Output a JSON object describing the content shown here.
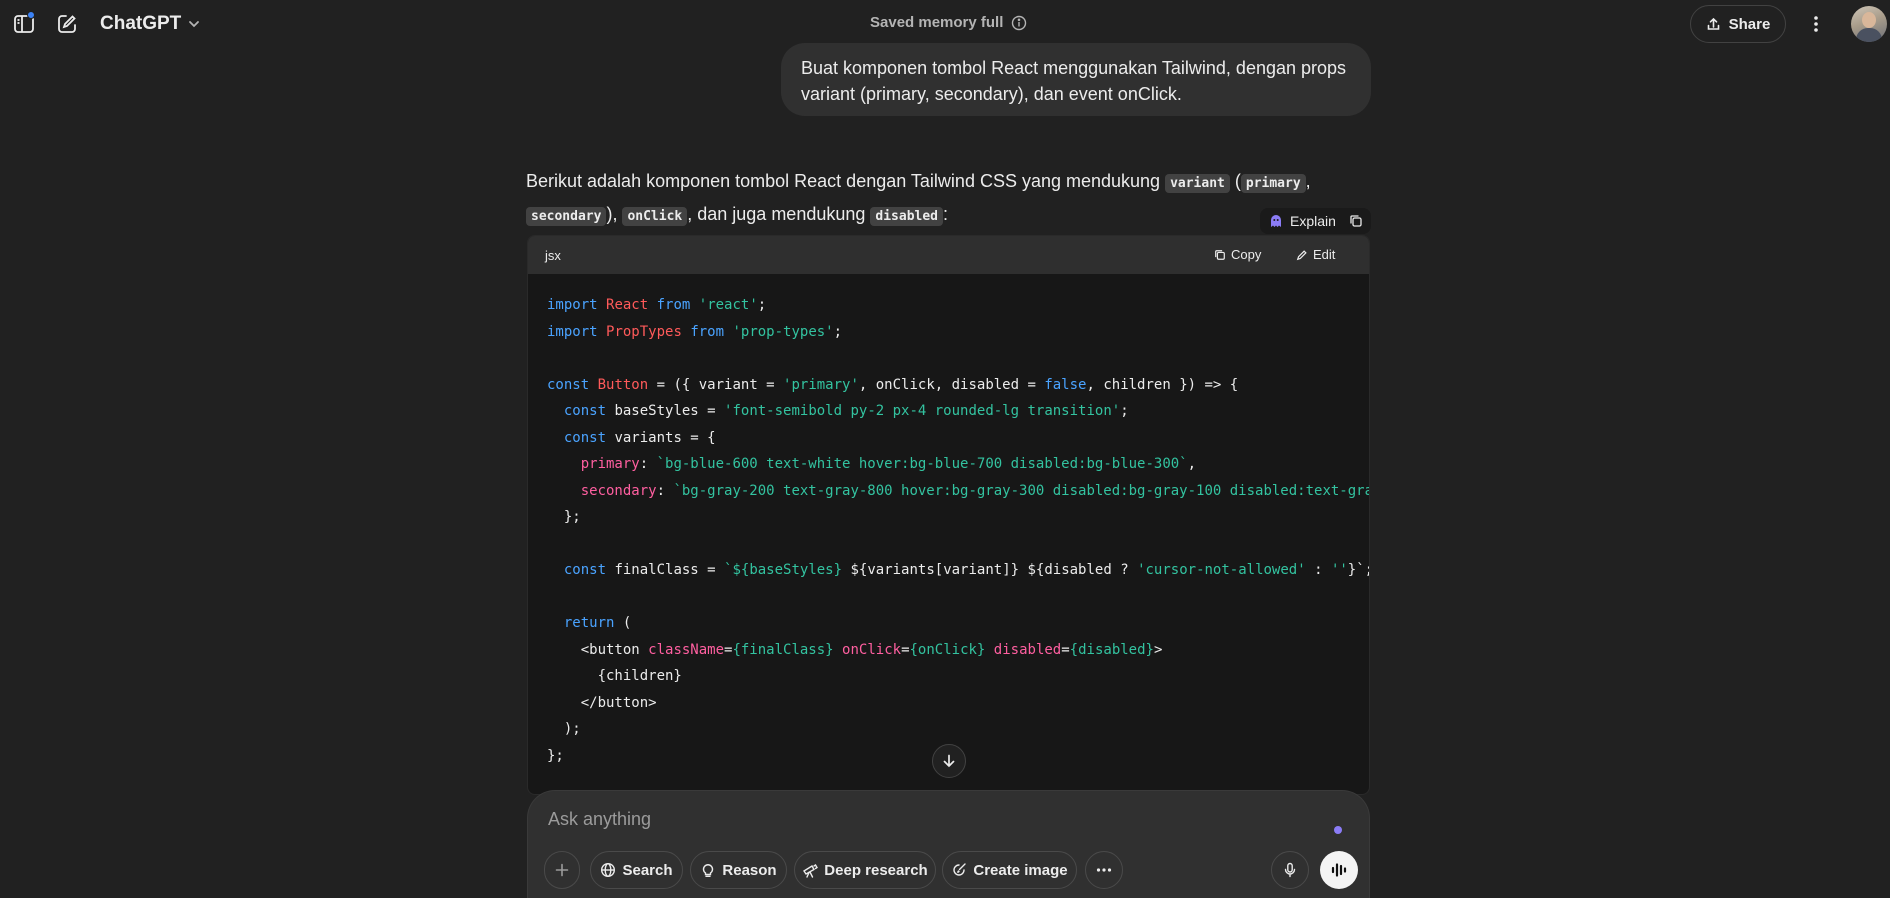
{
  "header": {
    "model_name": "ChatGPT",
    "memory_status": "Saved memory full",
    "share_label": "Share"
  },
  "user_message": {
    "text": "Buat komponen tombol React menggunakan Tailwind, dengan props variant (primary, secondary), dan event onClick."
  },
  "assistant": {
    "intro_1": "Berikut adalah komponen tombol React dengan Tailwind CSS yang mendukung ",
    "code_variant": "variant",
    "paren_open": " (",
    "code_primary": "primary",
    "comma_1": ",",
    "code_secondary": "secondary",
    "paren_close": "), ",
    "code_onclick": "onClick",
    "intro_2": ", dan juga mendukung ",
    "code_disabled": "disabled",
    "colon": ":",
    "explain_label": "Explain"
  },
  "code_block": {
    "language": "jsx",
    "copy_label": "Copy",
    "edit_label": "Edit",
    "lines": [
      [
        [
          "kw",
          "import"
        ],
        [
          "p",
          " "
        ],
        [
          "tp",
          "React"
        ],
        [
          "p",
          " "
        ],
        [
          "kw",
          "from"
        ],
        [
          "p",
          " "
        ],
        [
          "str",
          "'react'"
        ],
        [
          "p",
          ";"
        ]
      ],
      [
        [
          "kw",
          "import"
        ],
        [
          "p",
          " "
        ],
        [
          "tp",
          "PropTypes"
        ],
        [
          "p",
          " "
        ],
        [
          "kw",
          "from"
        ],
        [
          "p",
          " "
        ],
        [
          "str",
          "'prop-types'"
        ],
        [
          "p",
          ";"
        ]
      ],
      [],
      [
        [
          "kw",
          "const"
        ],
        [
          "p",
          " "
        ],
        [
          "tp",
          "Button"
        ],
        [
          "p",
          " = ({ variant = "
        ],
        [
          "str",
          "'primary'"
        ],
        [
          "p",
          ", onClick, disabled = "
        ],
        [
          "boo",
          "false"
        ],
        [
          "p",
          ", children }) => {"
        ]
      ],
      [
        [
          "p",
          "  "
        ],
        [
          "kw",
          "const"
        ],
        [
          "p",
          " baseStyles = "
        ],
        [
          "str",
          "'font-semibold py-2 px-4 rounded-lg transition'"
        ],
        [
          "p",
          ";"
        ]
      ],
      [
        [
          "p",
          "  "
        ],
        [
          "kw",
          "const"
        ],
        [
          "p",
          " variants = {"
        ]
      ],
      [
        [
          "p",
          "    "
        ],
        [
          "prop",
          "primary"
        ],
        [
          "p",
          ": "
        ],
        [
          "str",
          "`bg-blue-600 text-white hover:bg-blue-700 disabled:bg-blue-300`"
        ],
        [
          "p",
          ","
        ]
      ],
      [
        [
          "p",
          "    "
        ],
        [
          "prop",
          "secondary"
        ],
        [
          "p",
          ": "
        ],
        [
          "str",
          "`bg-gray-200 text-gray-800 hover:bg-gray-300 disabled:bg-gray-100 disabled:text-gra"
        ]
      ],
      [
        [
          "p",
          "  };"
        ]
      ],
      [],
      [
        [
          "p",
          "  "
        ],
        [
          "kw",
          "const"
        ],
        [
          "p",
          " finalClass = "
        ],
        [
          "str",
          "`${baseStyles}"
        ],
        [
          "p",
          " ${variants[variant]} ${disabled ? "
        ],
        [
          "str",
          "'cursor-not-allowed'"
        ],
        [
          "p",
          " : "
        ],
        [
          "str",
          "''"
        ],
        [
          "p",
          "}`;"
        ]
      ],
      [],
      [
        [
          "p",
          "  "
        ],
        [
          "kw",
          "return"
        ],
        [
          "p",
          " ("
        ]
      ],
      [
        [
          "p",
          "    <button "
        ],
        [
          "prop",
          "className"
        ],
        [
          "p",
          "="
        ],
        [
          "str",
          "{finalClass}"
        ],
        [
          "p",
          " "
        ],
        [
          "prop",
          "onClick"
        ],
        [
          "p",
          "="
        ],
        [
          "str",
          "{onClick}"
        ],
        [
          "p",
          " "
        ],
        [
          "prop",
          "disabled"
        ],
        [
          "p",
          "="
        ],
        [
          "str",
          "{disabled}"
        ],
        [
          "p",
          ">"
        ]
      ],
      [
        [
          "p",
          "      {children}"
        ]
      ],
      [
        [
          "p",
          "    </button>"
        ]
      ],
      [
        [
          "p",
          "  );"
        ]
      ],
      [
        [
          "p",
          "};"
        ]
      ]
    ]
  },
  "composer": {
    "placeholder": "Ask anything",
    "tools": {
      "search": "Search",
      "reason": "Reason",
      "deep_research": "Deep research",
      "create_image": "Create image"
    }
  }
}
